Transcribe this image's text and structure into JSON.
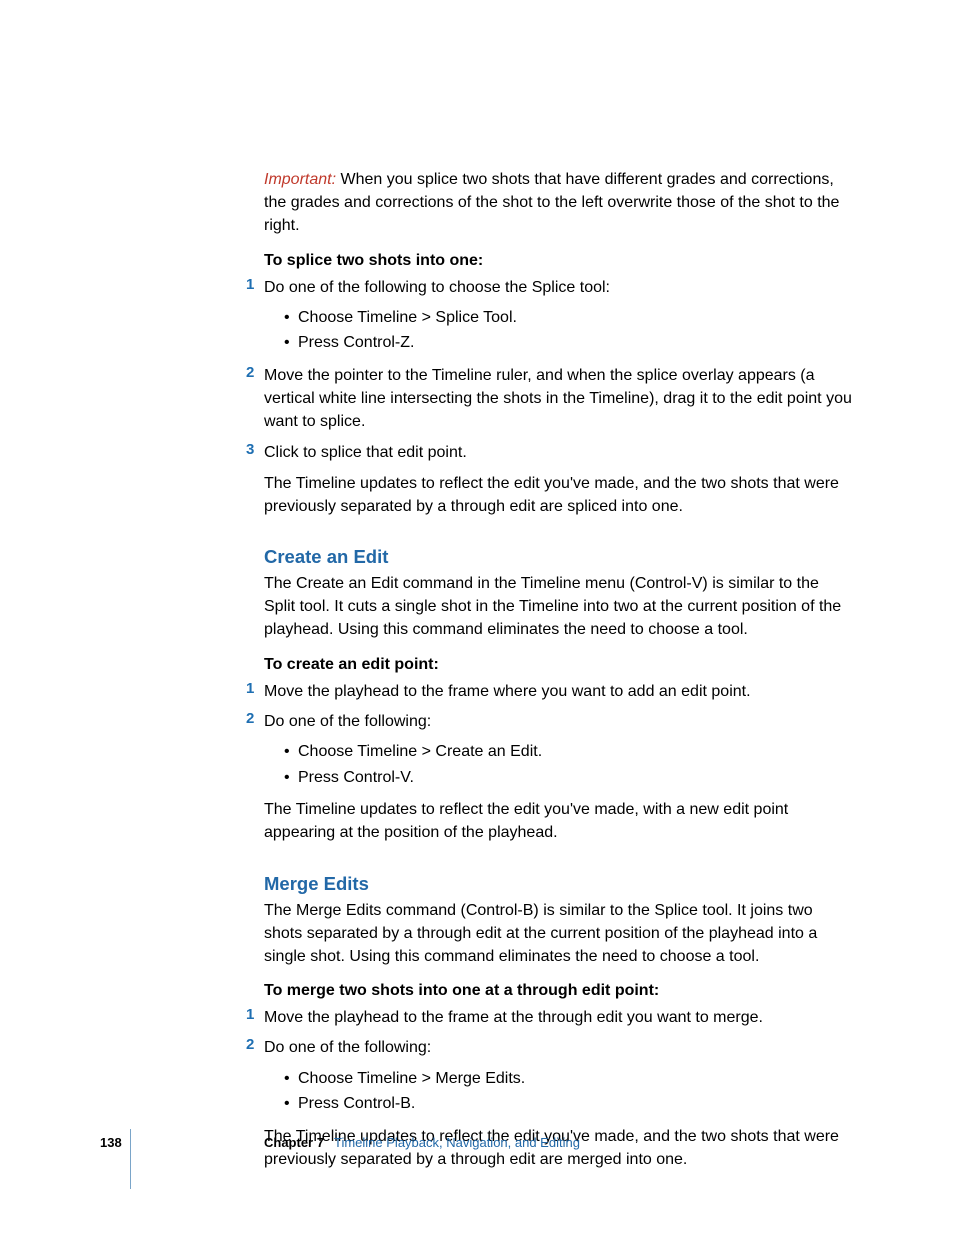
{
  "intro": {
    "important_label": "Important:",
    "important_text": "When you splice two shots that have different grades and corrections, the grades and corrections of the shot to the left overwrite those of the shot to the right."
  },
  "splice": {
    "task_title": "To splice two shots into one:",
    "step1": "Do one of the following to choose the Splice tool:",
    "step1_bullets": [
      "Choose Timeline > Splice Tool.",
      "Press Control-Z."
    ],
    "step2": "Move the pointer to the Timeline ruler, and when the splice overlay appears (a vertical white line intersecting the shots in the Timeline), drag it to the edit point you want to splice.",
    "step3": "Click to splice that edit point.",
    "followup": "The Timeline updates to reflect the edit you've made, and the two shots that were previously separated by a through edit are spliced into one."
  },
  "create_edit": {
    "heading": "Create an Edit",
    "intro": "The Create an Edit command in the Timeline menu (Control-V) is similar to the Split tool. It cuts a single shot in the Timeline into two at the current position of the playhead. Using this command eliminates the need to choose a tool.",
    "task_title": "To create an edit point:",
    "step1": "Move the playhead to the frame where you want to add an edit point.",
    "step2": "Do one of the following:",
    "step2_bullets": [
      "Choose Timeline > Create an Edit.",
      "Press Control-V."
    ],
    "followup": "The Timeline updates to reflect the edit you've made, with a new edit point appearing at the position of the playhead."
  },
  "merge_edits": {
    "heading": "Merge Edits",
    "intro": "The Merge Edits command (Control-B) is similar to the Splice tool. It joins two shots separated by a through edit at the current position of the playhead into a single shot. Using this command eliminates the need to choose a tool.",
    "task_title": "To merge two shots into one at a through edit point:",
    "step1": "Move the playhead to the frame at the through edit you want to merge.",
    "step2": "Do one of the following:",
    "step2_bullets": [
      "Choose Timeline > Merge Edits.",
      "Press Control-B."
    ],
    "followup": "The Timeline updates to reflect the edit you've made, and the two shots that were previously separated by a through edit are merged into one."
  },
  "footer": {
    "page_number": "138",
    "chapter_label": "Chapter 7",
    "chapter_title": "Timeline Playback, Navigation, and Editing"
  },
  "step_numbers": {
    "n1": "1",
    "n2": "2",
    "n3": "3"
  }
}
